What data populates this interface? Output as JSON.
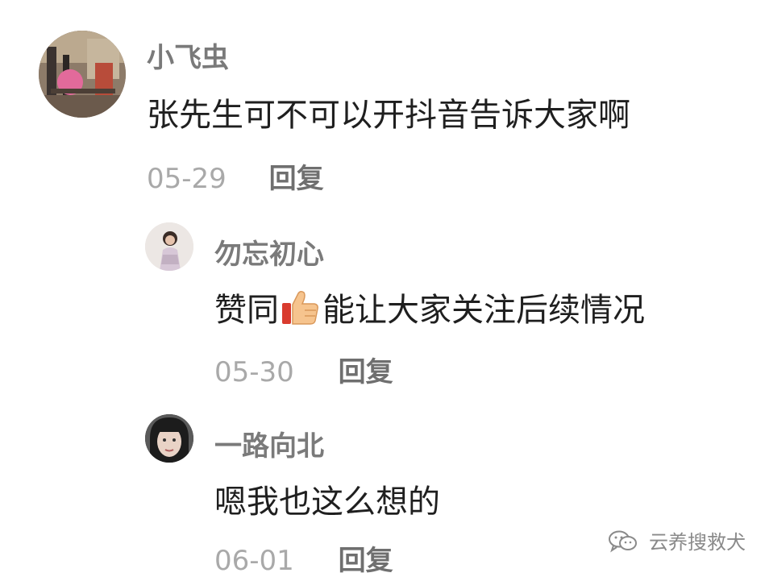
{
  "comments": [
    {
      "username": "小飞虫",
      "text": "张先生可不可以开抖音告诉大家啊",
      "date": "05-29",
      "reply_label": "回复"
    },
    {
      "username": "勿忘初心",
      "text_before_emoji": "赞同",
      "emoji": "thumbs-up-icon",
      "text_after_emoji": "能让大家关注后续情况",
      "date": "05-30",
      "reply_label": "回复"
    },
    {
      "username": "一路向北",
      "text": "嗯我也这么想的",
      "date": "06-01",
      "reply_label": "回复"
    }
  ],
  "watermark": {
    "icon": "wechat-icon",
    "text": "云养搜救犬"
  }
}
